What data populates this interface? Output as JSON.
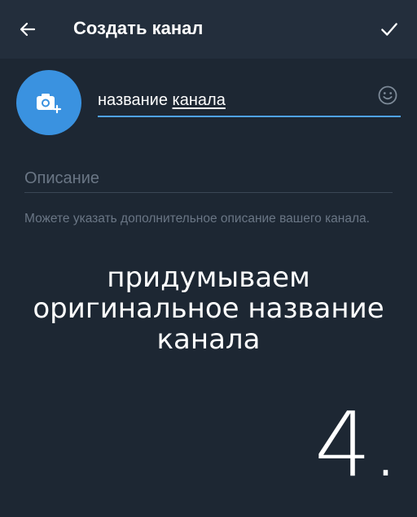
{
  "header": {
    "title": "Создать канал",
    "back_icon": "arrow-left-icon",
    "done_icon": "checkmark-icon"
  },
  "avatar": {
    "icon": "camera-add-icon",
    "color": "#3a92e0"
  },
  "name_field": {
    "value_part1": "название ",
    "value_part2": "канала",
    "emoji_icon": "smile-icon",
    "accent": "#4fa3f7"
  },
  "description_field": {
    "placeholder": "Описание",
    "hint": "Можете указать дополнительное описание вашего канала."
  },
  "overlay": {
    "caption_lines": [
      "придумываем",
      "оригинальное название",
      "канала"
    ],
    "step": "4."
  },
  "colors": {
    "background": "#1d2733",
    "header": "#232e3c",
    "muted_text": "#6a7685"
  }
}
